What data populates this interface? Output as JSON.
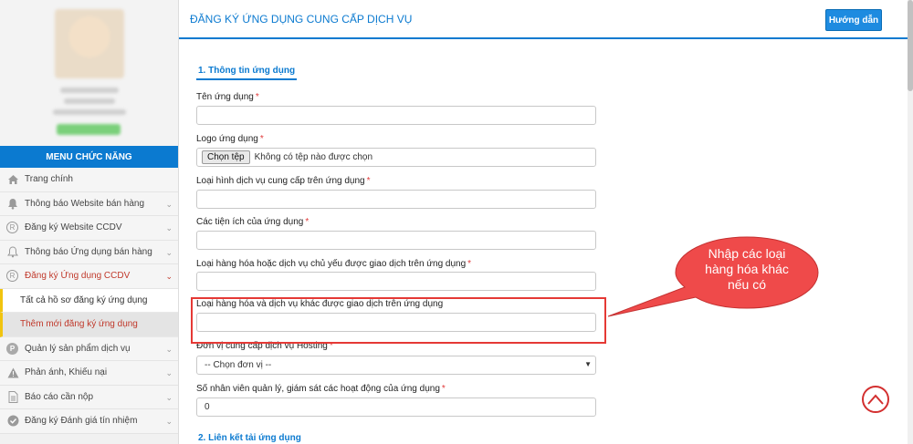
{
  "sidebar": {
    "menu_header": "MENU CHỨC NĂNG",
    "items": [
      {
        "label": "Trang chính",
        "icon": "home-icon"
      },
      {
        "label": "Thông báo Website bán hàng",
        "icon": "bell-icon"
      },
      {
        "label": "Đăng ký Website CCDV",
        "icon": "registered-icon"
      },
      {
        "label": "Thông báo Ứng dụng bán hàng",
        "icon": "bell-outline-icon"
      },
      {
        "label": "Đăng ký Ứng dụng CCDV",
        "icon": "registered-icon"
      },
      {
        "label": "Quản lý sản phẩm dịch vụ",
        "icon": "p-circle-icon"
      },
      {
        "label": "Phản ánh, Khiếu nại",
        "icon": "warning-icon"
      },
      {
        "label": "Báo cáo cần nộp",
        "icon": "document-icon"
      },
      {
        "label": "Đăng ký Đánh giá tín nhiệm",
        "icon": "check-circle-icon"
      }
    ],
    "submenu": [
      {
        "label": "Tất cả hồ sơ đăng ký ứng dụng"
      },
      {
        "label": "Thêm mới đăng ký ứng dụng"
      }
    ]
  },
  "header": {
    "title": "ĐĂNG KÝ ỨNG DỤNG CUNG CẤP DỊCH VỤ",
    "help_button": "Hướng dẫn"
  },
  "form": {
    "section1_title": "1. Thông tin ứng dụng",
    "section2_title": "2. Liên kết tải ứng dụng",
    "required_mark": "*",
    "fields": {
      "app_name": {
        "label": "Tên ứng dụng",
        "value": ""
      },
      "logo": {
        "label": "Logo ứng dụng",
        "button": "Chọn tệp",
        "status": "Không có tệp nào được chọn"
      },
      "service_type": {
        "label": "Loại hình dịch vụ cung cấp trên ứng dụng",
        "value": ""
      },
      "utilities": {
        "label": "Các tiện ích của ứng dụng",
        "value": ""
      },
      "main_goods": {
        "label": "Loại hàng hóa hoặc dịch vụ chủ yếu được giao dịch trên ứng dụng",
        "value": ""
      },
      "other_goods": {
        "label": "Loại hàng hóa và dịch vụ khác được giao dịch trên ứng dụng",
        "value": ""
      },
      "hosting": {
        "label": "Đơn vị cung cấp dịch vụ Hosting",
        "selected": "-- Chọn đơn vị --"
      },
      "staff_count": {
        "label": "Số nhân viên quản lý, giám sát các hoạt động của ứng dụng",
        "value": "0"
      }
    }
  },
  "callout": {
    "line1": "Nhập các loại",
    "line2": "hàng hóa khác",
    "line3": "nếu có",
    "color": "#ef4a4a"
  },
  "colors": {
    "accent": "#0b7ad0",
    "highlight": "#e53935"
  }
}
